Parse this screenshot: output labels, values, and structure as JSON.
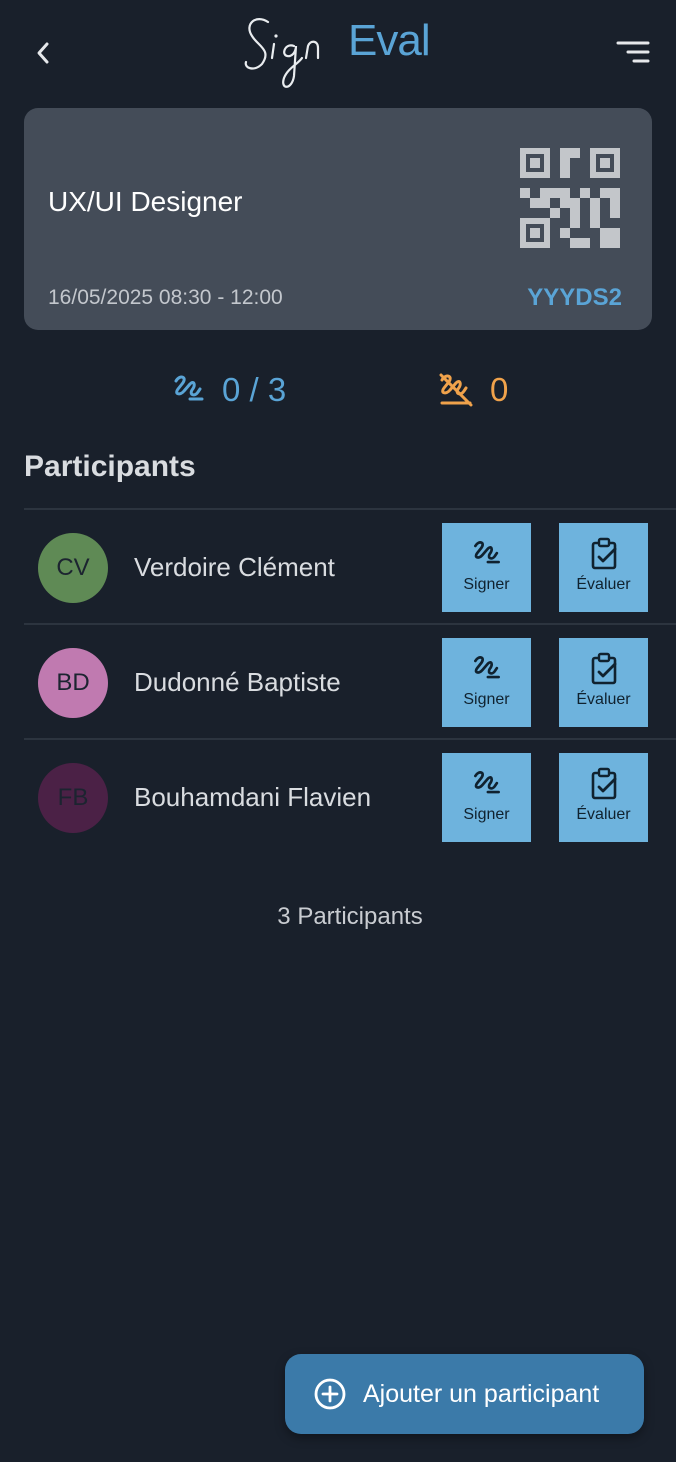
{
  "header": {
    "logo_sign": "Sign",
    "logo_eval": "Eval"
  },
  "session": {
    "title": "UX/UI Designer",
    "datetime": "16/05/2025 08:30 - 12:00",
    "code": "YYYDS2"
  },
  "stats": {
    "signed": "0 / 3",
    "absent": "0"
  },
  "participants_title": "Participants",
  "participants": [
    {
      "initials": "CV",
      "name": "Verdoire Clément",
      "avatar_color": "#5f8a55",
      "sign_label": "Signer",
      "eval_label": "Évaluer"
    },
    {
      "initials": "BD",
      "name": "Dudonné Baptiste",
      "avatar_color": "#c07ab0",
      "sign_label": "Signer",
      "eval_label": "Évaluer"
    },
    {
      "initials": "FB",
      "name": "Bouhamdani Flavien",
      "avatar_color": "#4b2146",
      "sign_label": "Signer",
      "eval_label": "Évaluer"
    }
  ],
  "participants_count": "3 Participants",
  "add_button_label": "Ajouter un participant",
  "colors": {
    "background": "#19202b",
    "accent": "#5aa4d6",
    "warning": "#f0a24b",
    "action": "#6eb3dd"
  }
}
